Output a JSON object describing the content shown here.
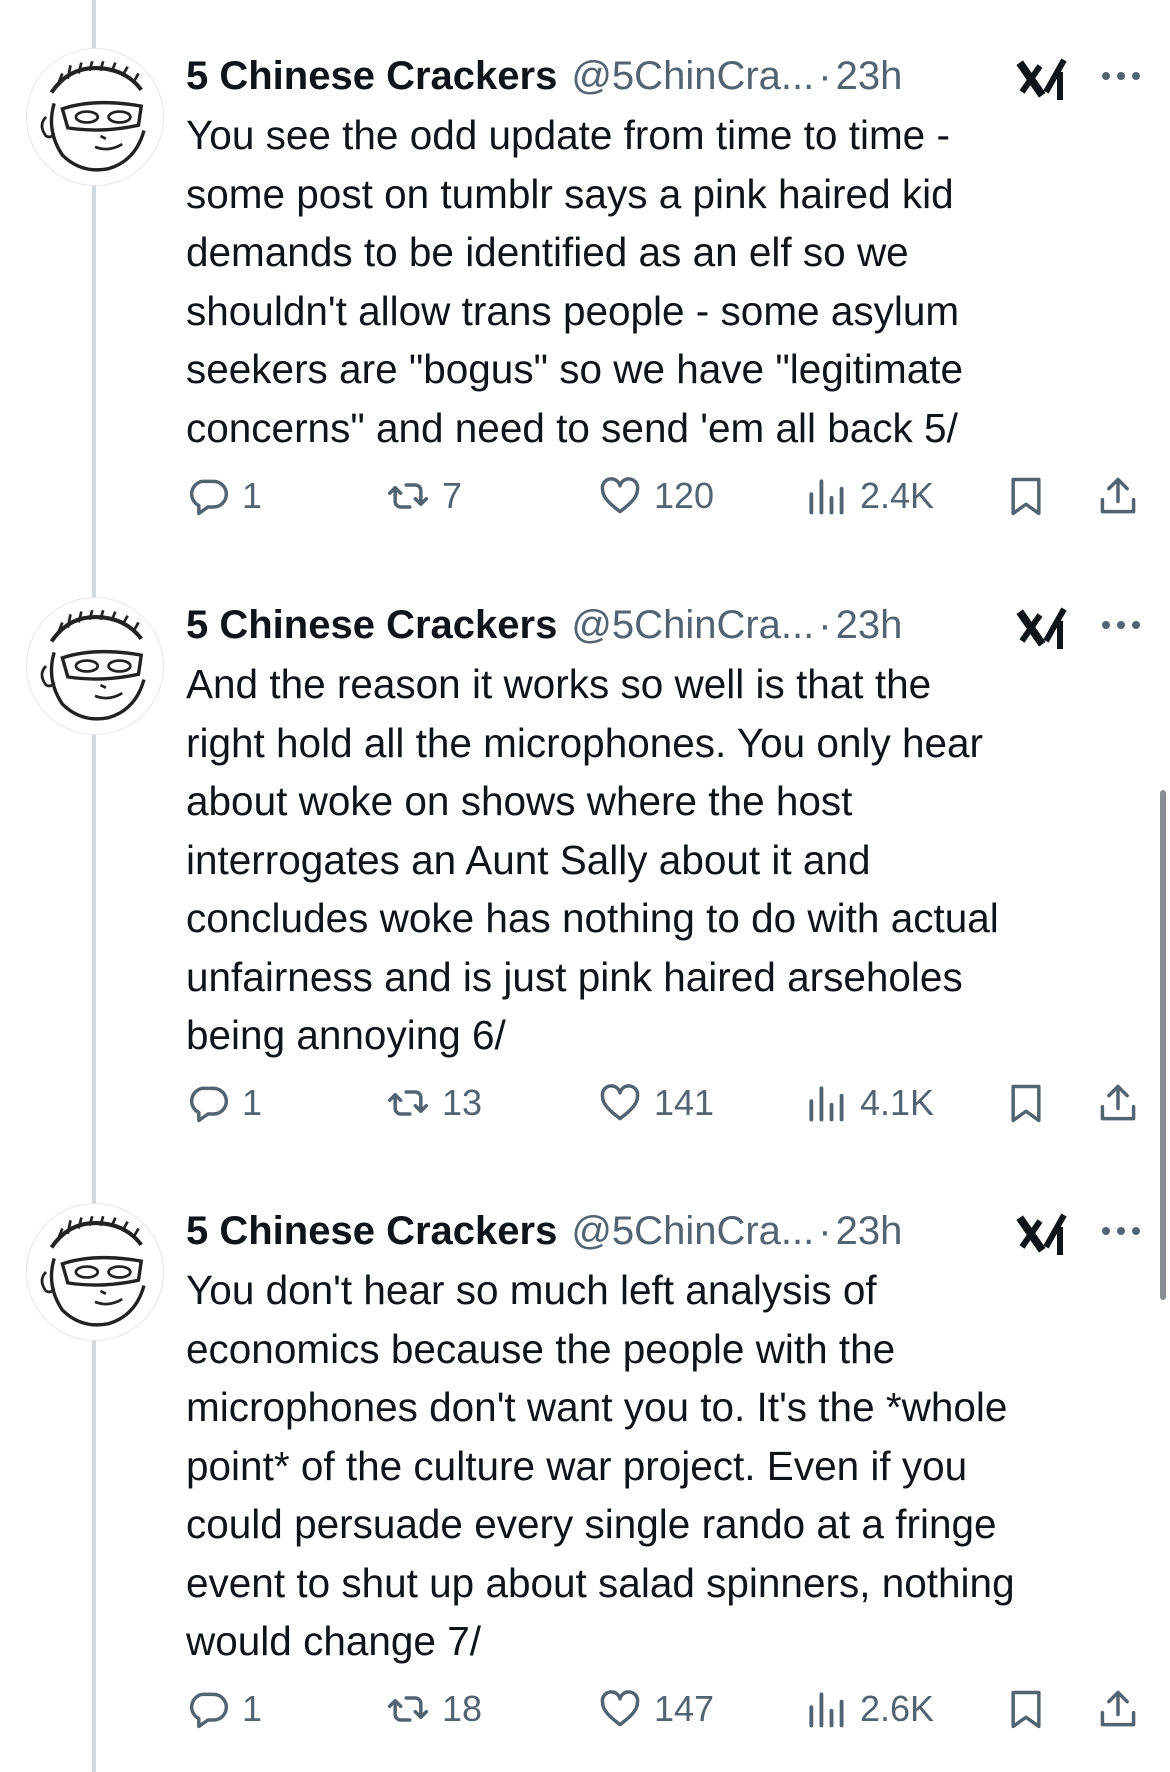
{
  "tweets": [
    {
      "author_name": "5 Chinese Crackers",
      "handle": "@5ChinCra...",
      "separator": "·",
      "time": "23h",
      "lines": [
        "You see the odd update from time to time -",
        "some post on tumblr says a pink haired kid",
        "demands to be identified as an elf so we",
        "shouldn't allow trans people - some asylum",
        "seekers are \"bogus\" so we have \"legitimate",
        "concerns\" and need to send 'em all back 5/"
      ],
      "replies": "1",
      "reposts": "7",
      "likes": "120",
      "views": "2.4K"
    },
    {
      "author_name": "5 Chinese Crackers",
      "handle": "@5ChinCra...",
      "separator": "·",
      "time": "23h",
      "lines": [
        "And the reason it works so well is that the",
        "right hold all the microphones. You only hear",
        "about woke on shows where the host",
        "interrogates an Aunt Sally about it and",
        "concludes woke has nothing to do with actual",
        "unfairness and is just pink haired arseholes",
        "being annoying 6/"
      ],
      "replies": "1",
      "reposts": "13",
      "likes": "141",
      "views": "4.1K"
    },
    {
      "author_name": "5 Chinese Crackers",
      "handle": "@5ChinCra...",
      "separator": "·",
      "time": "23h",
      "lines": [
        "You don't hear so much left analysis of",
        "economics because the people with the",
        "microphones don't want you to. It's the *whole",
        "point* of the culture war project. Even if you",
        "could persuade every single rando at a fringe",
        "event to shut up about salad spinners, nothing",
        "would change 7/"
      ],
      "replies": "1",
      "reposts": "18",
      "likes": "147",
      "views": "2.6K"
    }
  ],
  "icons": {
    "avatar": "cartoon-face-avatar",
    "grok": "grok-icon",
    "more": "more-icon",
    "reply": "reply-icon",
    "repost": "repost-icon",
    "like": "like-icon",
    "views": "views-icon",
    "bookmark": "bookmark-icon",
    "share": "share-icon"
  },
  "colors": {
    "text": "#0f1419",
    "secondary": "#536471",
    "thread_line": "#cfd9de"
  }
}
